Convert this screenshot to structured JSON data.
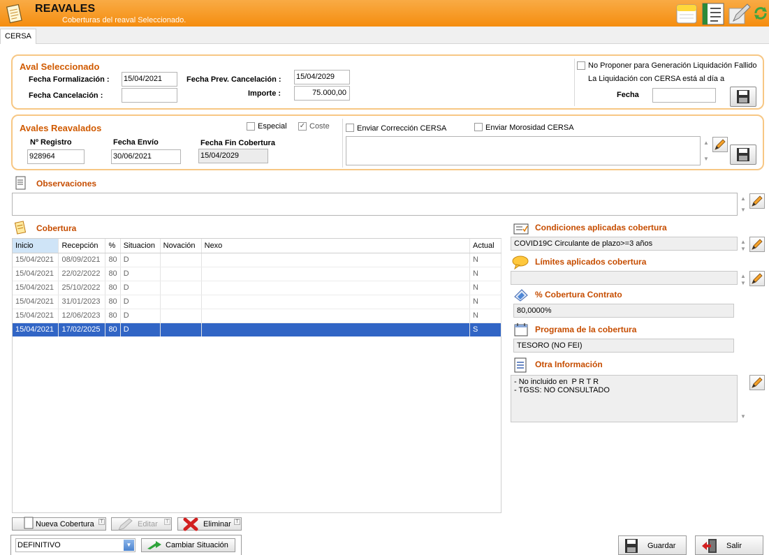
{
  "header": {
    "title": "REAVALES",
    "subtitle": "Coberturas del reaval Seleccionado."
  },
  "tabs": [
    {
      "label": "CERSA"
    }
  ],
  "aval": {
    "title": "Aval Seleccionado",
    "fecha_formalizacion_label": "Fecha Formalización :",
    "fecha_formalizacion": "15/04/2021",
    "fecha_cancelacion_label": "Fecha Cancelación :",
    "fecha_cancelacion": "",
    "fecha_prev_cancelacion_label": "Fecha Prev. Cancelación :",
    "fecha_prev_cancelacion": "15/04/2029",
    "importe_label": "Importe :",
    "importe": "75.000,00",
    "no_proponer_label": "No Proponer para Generación Liquidación Fallido",
    "liquidacion_label": "La Liquidación con CERSA está al día a",
    "fecha_label": "Fecha",
    "fecha": ""
  },
  "reavalados": {
    "title": "Avales Reavalados",
    "especial_label": "Especial",
    "especial_checked": false,
    "coste_label": "Coste",
    "coste_checked": true,
    "registro_label": "Nº Registro",
    "registro": "928964",
    "fecha_envio_label": "Fecha Envío",
    "fecha_envio": "30/06/2021",
    "fecha_fin_label": "Fecha Fin Cobertura",
    "fecha_fin": "15/04/2029",
    "correccion_label": "Enviar Corrección CERSA",
    "morosidad_label": "Enviar Morosidad CERSA",
    "correccion_text": ""
  },
  "observaciones": {
    "title": "Observaciones",
    "text": ""
  },
  "cobertura": {
    "title": "Cobertura",
    "columns": [
      "Inicio",
      "Recepción",
      "%",
      "Situacion",
      "Novación",
      "Nexo",
      "Actual"
    ],
    "rows": [
      [
        "15/04/2021",
        "08/09/2021",
        "80",
        "D",
        "",
        "",
        "N"
      ],
      [
        "15/04/2021",
        "22/02/2022",
        "80",
        "D",
        "",
        "",
        "N"
      ],
      [
        "15/04/2021",
        "25/10/2022",
        "80",
        "D",
        "",
        "",
        "N"
      ],
      [
        "15/04/2021",
        "31/01/2023",
        "80",
        "D",
        "",
        "",
        "N"
      ],
      [
        "15/04/2021",
        "12/06/2023",
        "80",
        "D",
        "",
        "",
        "N"
      ],
      [
        "15/04/2021",
        "17/02/2025",
        "80",
        "D",
        "",
        "",
        "S"
      ]
    ],
    "selected_row": 5
  },
  "condiciones": {
    "title": "Condiciones aplicadas cobertura",
    "value": "COVID19C Circulante de plazo>=3 años"
  },
  "limites": {
    "title": "Límites aplicados cobertura",
    "value": ""
  },
  "porcentaje": {
    "title": "% Cobertura Contrato",
    "value": "80,0000%"
  },
  "programa": {
    "title": "Programa de la cobertura",
    "value": "TESORO (NO FEI)"
  },
  "otra": {
    "title": "Otra Información",
    "line1": "- No incluido en  P R T R",
    "line2": "- TGSS: NO CONSULTADO"
  },
  "buttons": {
    "nueva": "Nueva Cobertura",
    "editar": "Editar",
    "eliminar": "Eliminar",
    "situacion_value": "DEFINITIVO",
    "cambiar": "Cambiar Situación",
    "guardar": "Guardar",
    "salir": "Salir"
  },
  "colors": {
    "header_orange": "#f58d0f",
    "group_border": "#f7c784",
    "section_title": "#c64d00",
    "selected_row": "#3165c5"
  }
}
